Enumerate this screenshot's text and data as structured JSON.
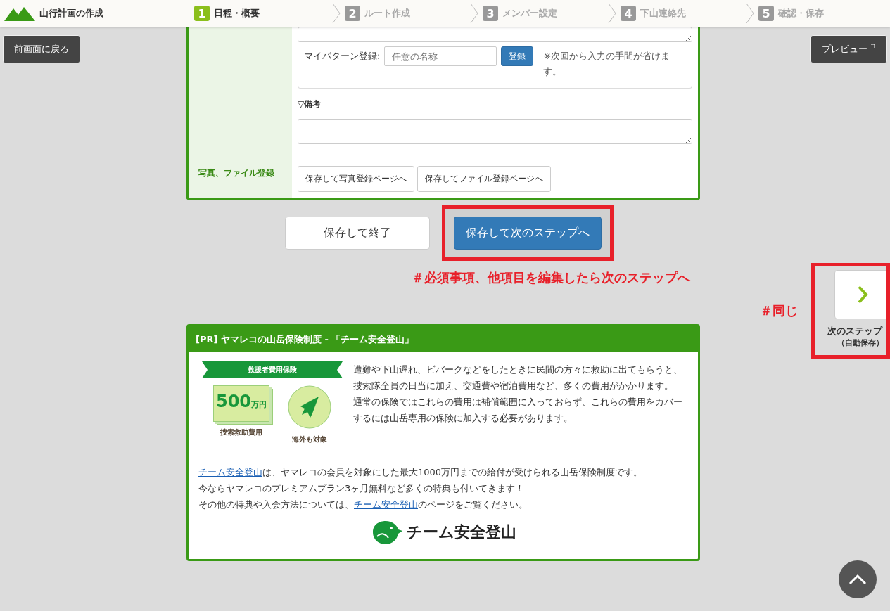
{
  "header": {
    "title": "山行計画の作成",
    "steps": [
      {
        "number": "1",
        "label": "日程・概要",
        "selected": true
      },
      {
        "number": "2",
        "label": "ルート作成",
        "selected": false
      },
      {
        "number": "3",
        "label": "メンバー設定",
        "selected": false
      },
      {
        "number": "4",
        "label": "下山連絡先",
        "selected": false
      },
      {
        "number": "5",
        "label": "確認・保存",
        "selected": false
      }
    ]
  },
  "back_button": "前画面に戻る",
  "preview_button": "プレビュー",
  "form": {
    "pattern_label": "マイパターン登録:",
    "pattern_placeholder": "任意の名称",
    "register_button": "登録",
    "pattern_note": "※次回から入力の手間が省けます。",
    "remarks_label": "▽備考",
    "photo_label": "写真、ファイル登録",
    "photo_buttons": [
      "保存して写真登録ページへ",
      "保存してファイル登録ページへ"
    ]
  },
  "actions": [
    {
      "label": "保存して終了",
      "kind": "secondary",
      "highlighted": false
    },
    {
      "label": "保存して次のステップへ",
      "kind": "primary",
      "highlighted": true
    }
  ],
  "annotations": {
    "main": "＃必須事項、他項目を編集したら次のステップへ",
    "side": "＃同じ"
  },
  "next_step": {
    "label": "次のステップ",
    "sub": "（自動保存）",
    "highlighted": true
  },
  "pr": {
    "title": "[PR] ヤマレコの山岳保険制度 - 「チーム安全登山」",
    "ribbon": "救援者費用保険",
    "amount": "500",
    "unit": "万円",
    "captions": [
      "捜索救助費用",
      "海外も対象"
    ],
    "intro": [
      "遭難や下山遅れ、ビバークなどをしたときに民間の方々に救助に出てもらうと、捜索隊全員の日当に加え、交通費や宿泊費用など、多くの費用がかかります。",
      "通常の保険ではこれらの費用は補償範囲に入っておらず、これらの費用をカバーするには山岳専用の保険に加入する必要があります。"
    ],
    "lines": [
      [
        {
          "text": "チーム安全登山",
          "link": true
        },
        {
          "text": "は、ヤマレコの会員を対象にした最大1000万円までの給付が受けられる山岳保険制度です。",
          "link": false
        }
      ],
      [
        {
          "text": "今ならヤマレコのプレミアムプラン3ヶ月無料など多くの特典も付いてきます！",
          "link": false
        }
      ],
      [
        {
          "text": "その他の特典や入会方法については、",
          "link": false
        },
        {
          "text": "チーム安全登山",
          "link": true
        },
        {
          "text": "のページをご覧ください。",
          "link": false
        }
      ]
    ],
    "logo": "チーム安全登山"
  }
}
